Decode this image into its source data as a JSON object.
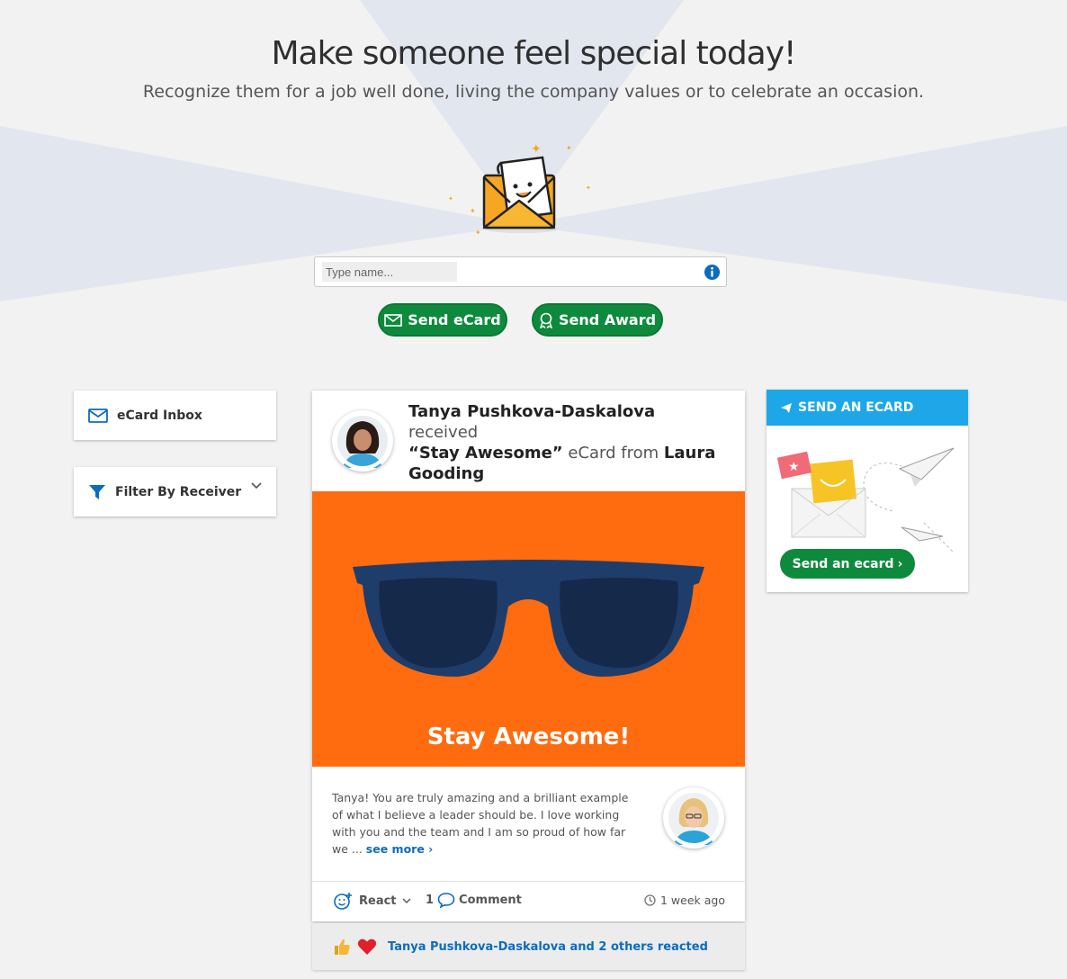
{
  "hero": {
    "title": "Make someone feel special today!",
    "subtitle": "Recognize them for a job well done, living the company values or to celebrate an occasion."
  },
  "search": {
    "placeholder": "Type name...",
    "value": ""
  },
  "actions": {
    "send_ecard": "Send eCard",
    "send_award": "Send Award"
  },
  "sidebar": {
    "inbox": "eCard Inbox",
    "filter": "Filter By Receiver"
  },
  "post": {
    "receiver": "Tanya Pushkova-Daskalova",
    "received": "received",
    "card_name": "“Stay Awesome”",
    "ecard_from": "eCard from",
    "sender": "Laura Gooding",
    "card_caption": "Stay Awesome!",
    "message": "Tanya! You are truly amazing and a brilliant example of what I believe a leader should be. I love working with you and the team and I am so proud of how far we ...",
    "see_more": "see more ›",
    "react_label": "React",
    "comment_count": "1",
    "comment_label": "Comment",
    "time_ago": "1 week ago"
  },
  "reactions": {
    "summary": "Tanya Pushkova-Daskalova and 2 others reacted"
  },
  "widget": {
    "heading": "SEND AN ECARD",
    "button": "Send an ecard",
    "button_chevron": "›"
  },
  "colors": {
    "accent_green": "#0e8a3c",
    "widget_blue": "#1ea7e8",
    "card_orange": "#ff6b0f",
    "link_blue": "#0b6cbf"
  }
}
